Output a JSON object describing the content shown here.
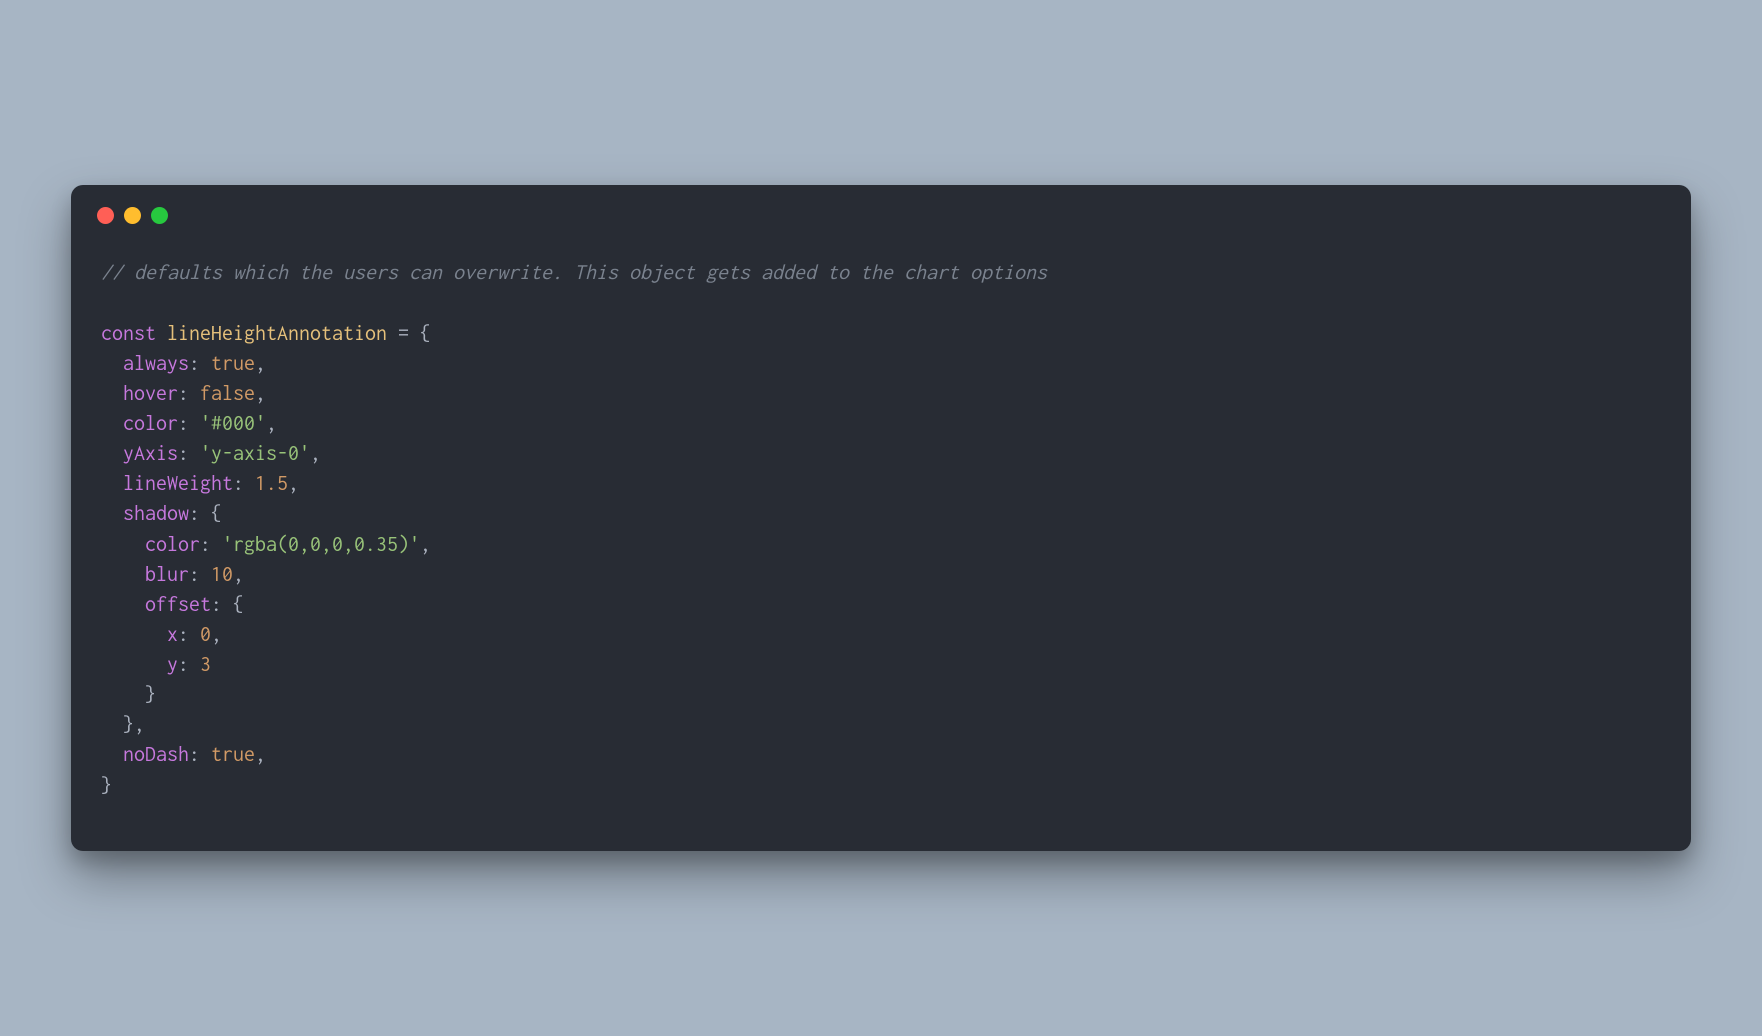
{
  "code": {
    "line1_comment": "// defaults which the users can overwrite. This object gets added to the chart options",
    "line3_const": "const",
    "line3_var": "lineHeightAnnotation",
    "line3_equals": " = {",
    "line4_key": "always",
    "line4_val": "true",
    "line5_key": "hover",
    "line5_val": "false",
    "line6_key": "color",
    "line6_val": "'#000'",
    "line7_key": "yAxis",
    "line7_val": "'y-axis-0'",
    "line8_key": "lineWeight",
    "line8_val": "1.5",
    "line9_key": "shadow",
    "line10_key": "color",
    "line10_val": "'rgba(0,0,0,0.35)'",
    "line11_key": "blur",
    "line11_val": "10",
    "line12_key": "offset",
    "line13_key": "x",
    "line13_val": "0",
    "line14_key": "y",
    "line14_val": "3",
    "line18_key": "noDash",
    "line18_val": "true",
    "indent1": "  ",
    "indent2": "    ",
    "indent3": "      ",
    "colon_sp": ": ",
    "comma": ",",
    "open_brace": "{",
    "close_brace": "}",
    "close_brace_comma": "},"
  }
}
